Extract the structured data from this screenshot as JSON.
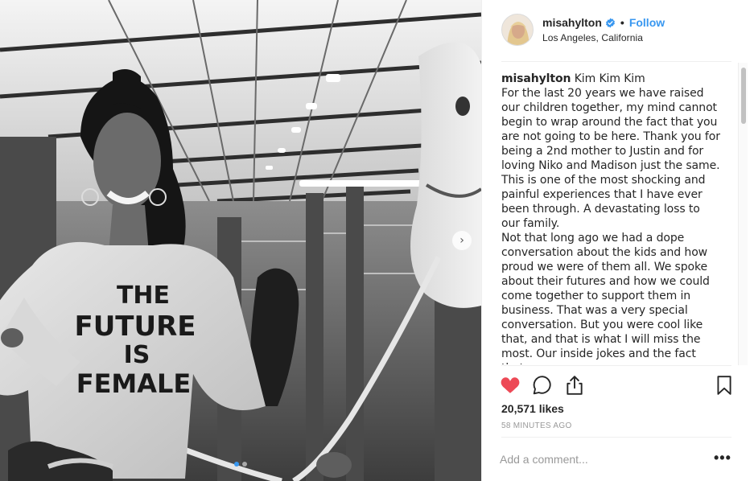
{
  "post": {
    "username": "misahylton",
    "follow_label": "Follow",
    "separator": "•",
    "location": "Los Angeles, California",
    "caption_username": "misahylton",
    "caption_text": " Kim Kim Kim\nFor the last 20 years we have raised our children together, my mind cannot begin to wrap around the fact that you are not going to be here. Thank you for being a 2nd mother to Justin and for loving Niko and Madison just the same. This is one of the most shocking and painful experiences that I have ever been through. A devastating loss to our family.\nNot that long ago we had a dope conversation about the kids and how proud we were of them all. We spoke about their futures and how we could come together to support them in business. That was a very special conversation. But you were cool like that, and that is what I will miss the most. Our inside jokes and the fact that",
    "likes": "20,571 likes",
    "timestamp": "58 MINUTES AGO",
    "comment_placeholder": "Add a comment...",
    "more_label": "•••"
  },
  "photo": {
    "shirt_text": [
      "THE",
      "FUTURE",
      "IS",
      "FEMALE"
    ]
  },
  "icons": {
    "verified": "verified-badge-icon",
    "like": "heart-icon",
    "comment": "comment-icon",
    "share": "share-icon",
    "save": "bookmark-icon",
    "next": "chevron-right-icon"
  },
  "colors": {
    "accent": "#3897f0",
    "like": "#ed4956",
    "muted": "#999999",
    "text": "#262626"
  }
}
